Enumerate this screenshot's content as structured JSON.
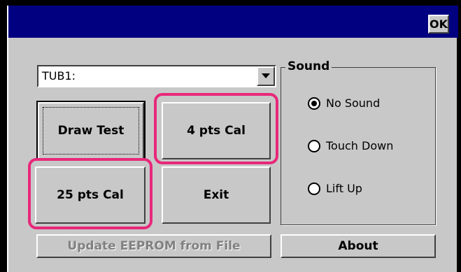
{
  "titlebar": {
    "ok_label": "OK"
  },
  "combo": {
    "value": "TUB1:"
  },
  "buttons": {
    "draw_test": "Draw Test",
    "cal4": "4 pts Cal",
    "cal25": "25 pts Cal",
    "exit": "Exit",
    "update_eeprom": "Update EEPROM from File",
    "about": "About"
  },
  "sound": {
    "title": "Sound",
    "selected": "No Sound",
    "options": [
      {
        "label": "No Sound",
        "checked": true
      },
      {
        "label": "Touch Down",
        "checked": false
      },
      {
        "label": "Lift Up",
        "checked": false
      }
    ]
  },
  "colors": {
    "titlebar": "#000080",
    "face": "#c8c8c8",
    "highlight": "#e8287a"
  }
}
